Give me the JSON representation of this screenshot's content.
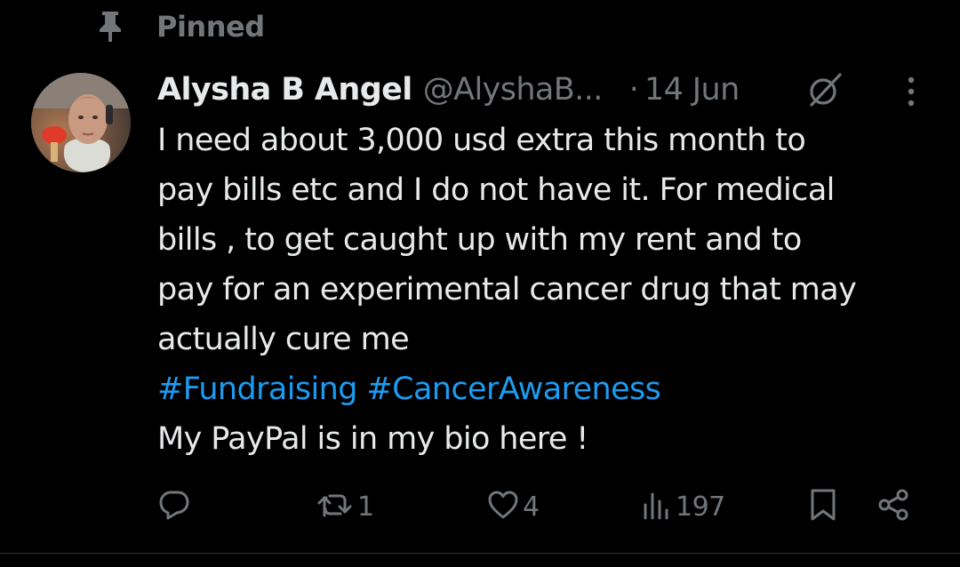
{
  "pinned": {
    "label": "Pinned",
    "icon": "pin-icon"
  },
  "post": {
    "author_name": "Alysha B Angel",
    "author_handle": "@AlyshaB...",
    "separator": "·",
    "date": "14 Jun",
    "text_lines": [
      "I need about 3,000 usd extra this month to",
      "pay bills etc and I do not have it. For medical",
      "bills , to get caught up with my rent and to",
      "pay for an experimental cancer drug that may",
      "actually cure me"
    ],
    "hashtags": [
      "#Fundraising",
      "#CancerAwareness"
    ],
    "closing_line": "My PayPal is in my bio here !"
  },
  "actions": {
    "reply": {
      "icon": "reply-icon",
      "count": ""
    },
    "repost": {
      "icon": "repost-icon",
      "count": "1"
    },
    "like": {
      "icon": "heart-icon",
      "count": "4"
    },
    "views": {
      "icon": "views-icon",
      "count": "197"
    },
    "bookmark": {
      "icon": "bookmark-icon"
    },
    "share": {
      "icon": "share-icon"
    }
  },
  "colors": {
    "background": "#000000",
    "primary_text": "#e7e9ea",
    "secondary_text": "#71767b",
    "link": "#1d9bf0",
    "divider": "#2f3336"
  }
}
